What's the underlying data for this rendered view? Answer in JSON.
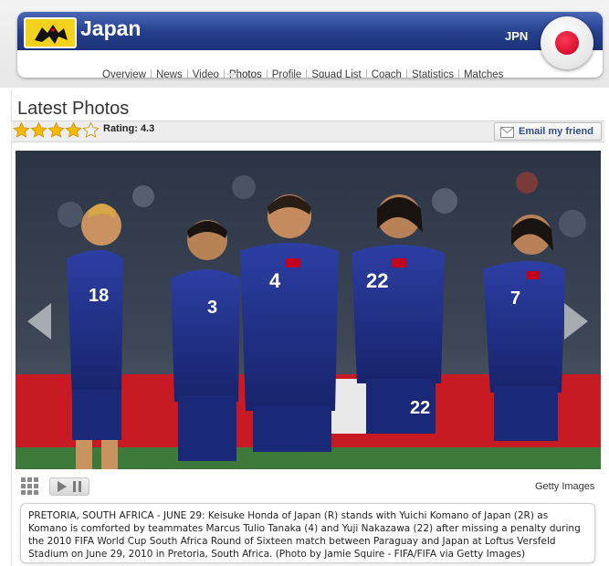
{
  "team": {
    "name": "Japan",
    "code": "JPN",
    "flag_color": "#d0021b",
    "logo_icon": "jfa-crow-emblem"
  },
  "nav": {
    "items": [
      "Overview",
      "News",
      "Video",
      "Photos",
      "Profile",
      "Squad List",
      "Coach",
      "Statistics",
      "Matches"
    ],
    "active": "Photos"
  },
  "section": {
    "title": "Latest Photos"
  },
  "rating": {
    "label": "Rating: 4.3",
    "value": 4.3,
    "max": 5,
    "star_color": "#f5b800"
  },
  "email_button": {
    "label": "Email my friend",
    "icon": "email-icon"
  },
  "photo": {
    "jersey_numbers": [
      "18",
      "3",
      "4",
      "22",
      "7"
    ],
    "shorts_number": "22",
    "jersey_color": "#1f2f8a",
    "credit": "Getty Images"
  },
  "caption": {
    "text": "PRETORIA, SOUTH AFRICA - JUNE 29: Keisuke Honda of Japan (R) stands with Yuichi Komano of Japan (2R) as Komano is comforted by teammates Marcus Tulio Tanaka (4) and Yuji Nakazawa (22) after missing a penalty during the 2010 FIFA World Cup South Africa Round of Sixteen match between Paraguay and Japan at Loftus Versfeld Stadium on June 29, 2010 in Pretoria, South Africa. (Photo by Jamie Squire - FIFA/FIFA via Getty Images)"
  }
}
